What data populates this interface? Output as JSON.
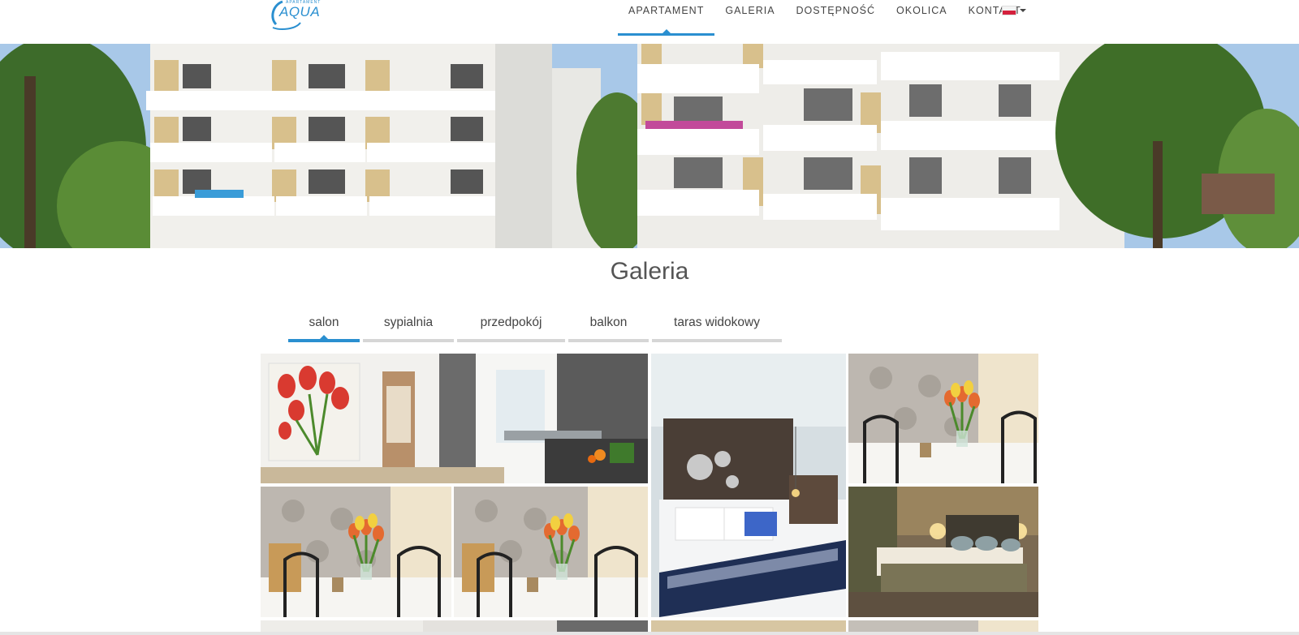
{
  "header": {
    "logo_text": "AQUA",
    "logo_small": "APARTAMENT",
    "nav": [
      {
        "label": "APARTAMENT",
        "active": true
      },
      {
        "label": "GALERIA",
        "active": false
      },
      {
        "label": "DOSTĘPNOŚĆ",
        "active": false
      },
      {
        "label": "OKOLICA",
        "active": false
      },
      {
        "label": "KONTAKT",
        "active": false
      }
    ],
    "language": "polish-flag-icon"
  },
  "gallery": {
    "title": "Galeria",
    "tabs": [
      {
        "label": "salon",
        "active": true
      },
      {
        "label": "sypialnia",
        "active": false
      },
      {
        "label": "przedpokój",
        "active": false
      },
      {
        "label": "balkon",
        "active": false
      },
      {
        "label": "taras widokowy",
        "active": false
      }
    ]
  },
  "colors": {
    "accent": "#2a8fd0",
    "tab_inactive": "#d6d6d6",
    "flag_red": "#d4213d"
  }
}
